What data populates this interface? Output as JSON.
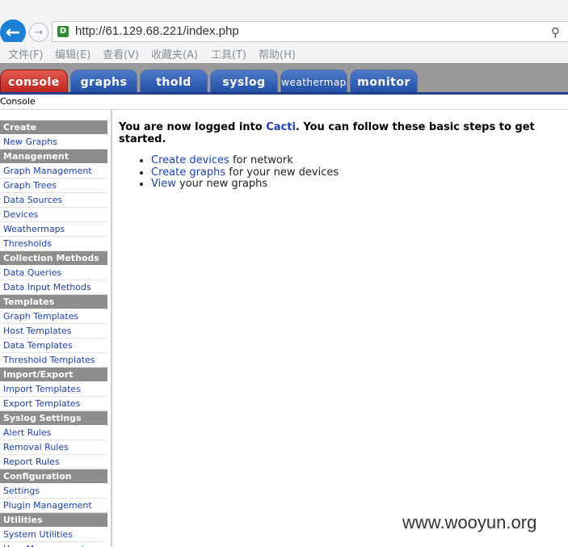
{
  "browser": {
    "url": "http://61.129.68.221/index.php",
    "menu": [
      "文件(F)",
      "编辑(E)",
      "查看(V)",
      "收藏夹(A)",
      "工具(T)",
      "帮助(H)"
    ]
  },
  "tabs": [
    "console",
    "graphs",
    "thold",
    "syslog",
    "weathermap",
    "monitor"
  ],
  "breadcrumb": "Console",
  "sidebar": {
    "items": [
      {
        "label": "Create",
        "type": "section"
      },
      {
        "label": "New Graphs",
        "type": "link"
      },
      {
        "label": "Management",
        "type": "section"
      },
      {
        "label": "Graph Management",
        "type": "link"
      },
      {
        "label": "Graph Trees",
        "type": "link"
      },
      {
        "label": "Data Sources",
        "type": "link"
      },
      {
        "label": "Devices",
        "type": "link"
      },
      {
        "label": "Weathermaps",
        "type": "link"
      },
      {
        "label": "Thresholds",
        "type": "link"
      },
      {
        "label": "Collection Methods",
        "type": "section"
      },
      {
        "label": "Data Queries",
        "type": "link"
      },
      {
        "label": "Data Input Methods",
        "type": "link"
      },
      {
        "label": "Templates",
        "type": "section"
      },
      {
        "label": "Graph Templates",
        "type": "link"
      },
      {
        "label": "Host Templates",
        "type": "link"
      },
      {
        "label": "Data Templates",
        "type": "link"
      },
      {
        "label": "Threshold Templates",
        "type": "link"
      },
      {
        "label": "Import/Export",
        "type": "section"
      },
      {
        "label": "Import Templates",
        "type": "link"
      },
      {
        "label": "Export Templates",
        "type": "link"
      },
      {
        "label": "Syslog Settings",
        "type": "section"
      },
      {
        "label": "Alert Rules",
        "type": "link"
      },
      {
        "label": "Removal Rules",
        "type": "link"
      },
      {
        "label": "Report Rules",
        "type": "link"
      },
      {
        "label": "Configuration",
        "type": "section"
      },
      {
        "label": "Settings",
        "type": "link"
      },
      {
        "label": "Plugin Management",
        "type": "link"
      },
      {
        "label": "Utilities",
        "type": "section"
      },
      {
        "label": "System Utilities",
        "type": "link"
      },
      {
        "label": "User Management",
        "type": "link"
      }
    ]
  },
  "main": {
    "welcome_prefix": "You are now logged into ",
    "welcome_app": "Cacti",
    "welcome_suffix": ". You can follow these basic steps to get started.",
    "steps": [
      {
        "link": "Create devices",
        "text": " for network"
      },
      {
        "link": "Create graphs",
        "text": " for your new devices"
      },
      {
        "link": "View",
        "text": " your new graphs"
      }
    ]
  },
  "watermark": "www.wooyun.org",
  "colors": {
    "link": "#1b3fb5",
    "tab_active": "#c9302c",
    "tab": "#2d5bb3",
    "section_bg": "#8d8d8d"
  }
}
